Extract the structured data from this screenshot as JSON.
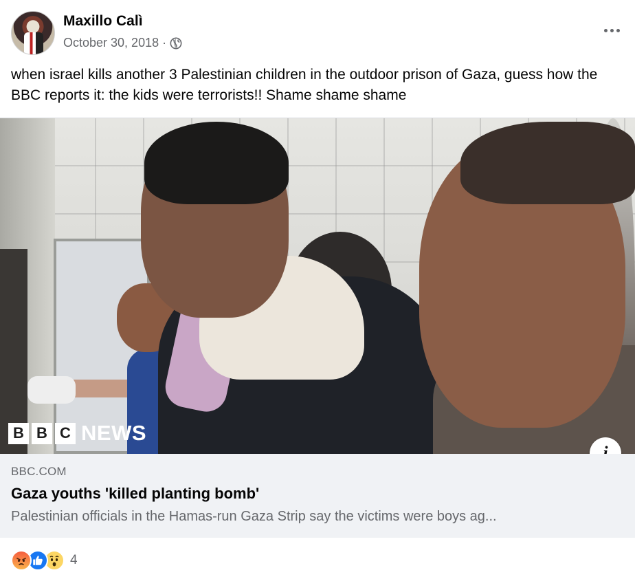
{
  "post": {
    "author": "Maxillo Calì",
    "date": "October 30, 2018",
    "separator": "·",
    "privacy_icon": "globe-icon",
    "more_icon": "more-options-icon",
    "text": "when israel kills another 3 Palestinian children in the outdoor prison of Gaza, guess how the BBC reports it: the kids were terrorists!! Shame shame shame"
  },
  "link": {
    "image_logo_text": [
      "B",
      "B",
      "C"
    ],
    "image_logo_news": "NEWS",
    "info_icon": "info-icon",
    "info_label": "i",
    "domain": "BBC.COM",
    "title": "Gaza youths 'killed planting bomb'",
    "description": "Palestinian officials in the Hamas-run Gaza Strip say the victims were boys ag..."
  },
  "reactions": {
    "icons": [
      "angry-reaction-icon",
      "like-reaction-icon",
      "wow-reaction-icon"
    ],
    "count": "4"
  },
  "colors": {
    "meta_gray": "#65676b",
    "link_bg": "#f0f2f5",
    "like_blue": "#1877f2"
  }
}
